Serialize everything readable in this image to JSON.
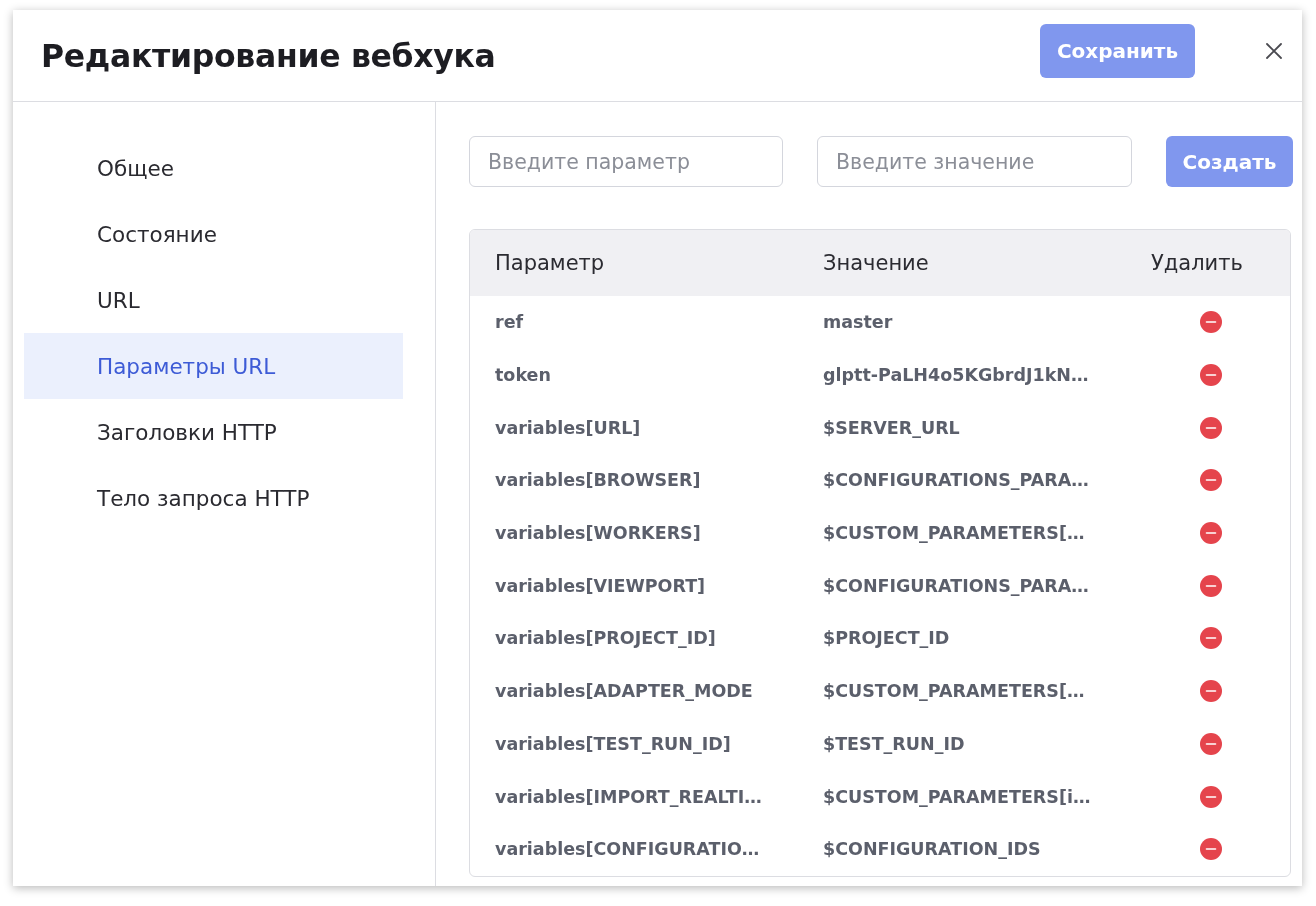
{
  "dialog": {
    "title": "Редактирование вебхука",
    "save_button": {
      "label": "Сохранить",
      "disabled": true
    }
  },
  "sidebar": {
    "items": [
      {
        "label": "Общее",
        "selected": false
      },
      {
        "label": "Состояние",
        "selected": false
      },
      {
        "label": "URL",
        "selected": false
      },
      {
        "label": "Параметры URL",
        "selected": true
      },
      {
        "label": "Заголовки HTTP",
        "selected": false
      },
      {
        "label": "Тело запроса HTTP",
        "selected": false
      }
    ]
  },
  "param_form": {
    "parameter_field": {
      "placeholder": "Введите параметр"
    },
    "value_field": {
      "placeholder": "Введите значение"
    },
    "create_button": {
      "label": "Создать",
      "disabled": true
    }
  },
  "table": {
    "columns": [
      "Параметр",
      "Значение",
      "Удалить"
    ],
    "rows": [
      {
        "parameter": "ref",
        "value": "master"
      },
      {
        "parameter": "token",
        "value": "glptt-PaLH4o5KGbrdJ1kN…"
      },
      {
        "parameter": "variables[URL]",
        "value": "$SERVER_URL"
      },
      {
        "parameter": "variables[BROWSER]",
        "value": "$CONFIGURATIONS_PARA…"
      },
      {
        "parameter": "variables[WORKERS]",
        "value": "$CUSTOM_PARAMETERS[…"
      },
      {
        "parameter": "variables[VIEWPORT]",
        "value": "$CONFIGURATIONS_PARA…"
      },
      {
        "parameter": "variables[PROJECT_ID]",
        "value": "$PROJECT_ID"
      },
      {
        "parameter": "variables[ADAPTER_MODE",
        "value": "$CUSTOM_PARAMETERS[…"
      },
      {
        "parameter": "variables[TEST_RUN_ID]",
        "value": "$TEST_RUN_ID"
      },
      {
        "parameter": "variables[IMPORT_REALTI…",
        "value": "$CUSTOM_PARAMETERS[i…"
      },
      {
        "parameter": "variables[CONFIGURATIO…",
        "value": "$CONFIGURATION_IDS"
      }
    ]
  }
}
